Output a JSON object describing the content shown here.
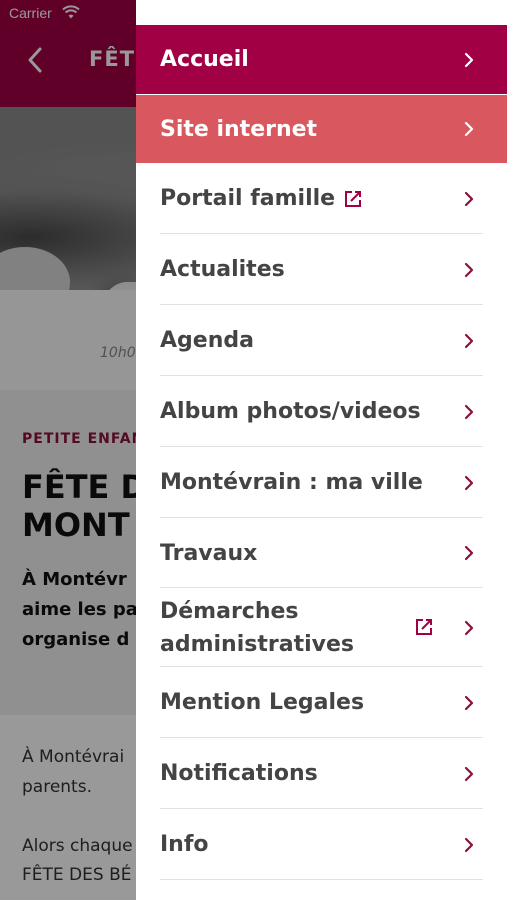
{
  "status_bar": {
    "carrier": "Carrier"
  },
  "background_page": {
    "header_title": "FÊTE",
    "time_text": "10h0",
    "category": "PETITE ENFAN",
    "heading_lines": [
      "FÊTE D",
      "MONT"
    ],
    "lead_lines": [
      "À Montévr",
      "aime les pa",
      "organise d"
    ],
    "body_lines": [
      "À Montévrai",
      "parents.",
      "Alors chaque",
      "FÊTE DES BÉ"
    ]
  },
  "menu": {
    "items": [
      {
        "label": "Accueil"
      },
      {
        "label": "Site internet"
      },
      {
        "label": "Portail famille"
      },
      {
        "label": "Actualites"
      },
      {
        "label": "Agenda"
      },
      {
        "label": "Album photos/videos"
      },
      {
        "label": "Montévrain : ma ville"
      },
      {
        "label": "Travaux"
      },
      {
        "label": "Démarches administratives"
      },
      {
        "label": "Mention Legales"
      },
      {
        "label": "Notifications"
      },
      {
        "label": "Info"
      }
    ]
  },
  "colors": {
    "primary": "#a10044",
    "secondary": "#d9585f",
    "text": "#444444",
    "chevron": "#8c1138"
  },
  "icons": {
    "external_link": "external-link-icon",
    "chevron": "chevron-right-icon",
    "back": "chevron-left-icon",
    "wifi": "wifi-icon"
  }
}
